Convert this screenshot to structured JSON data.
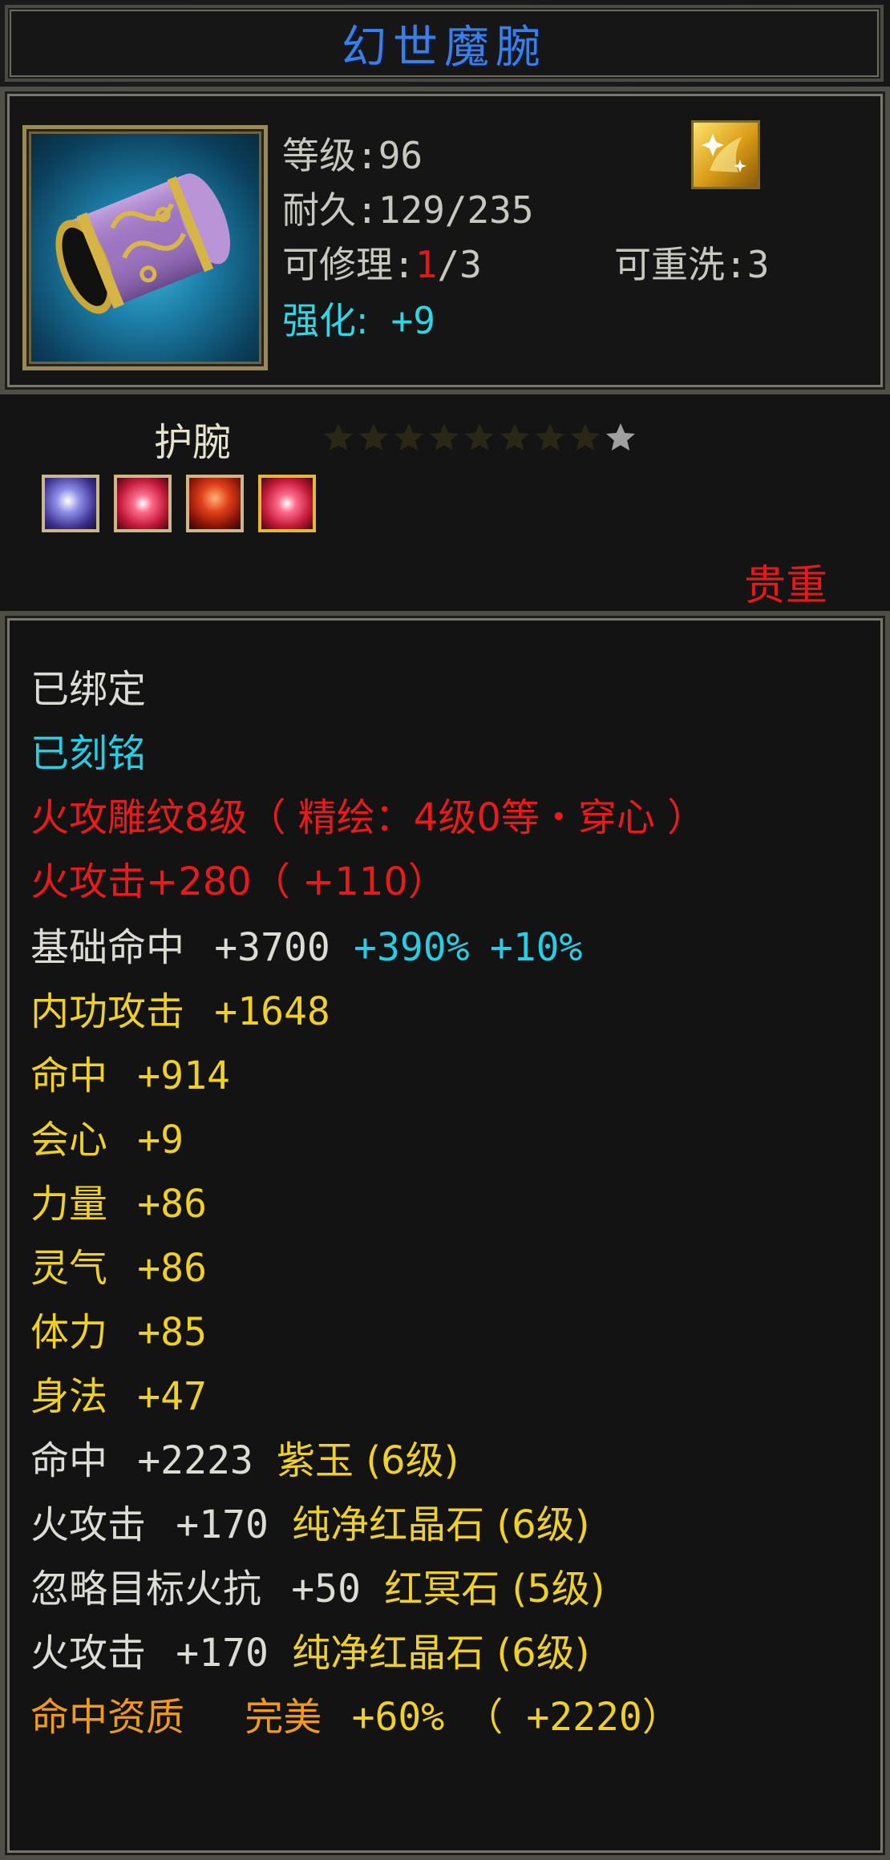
{
  "title": "幻世魔腕",
  "header": {
    "level_label": "等级",
    "level_value": ":96",
    "durability_label": "耐久",
    "durability_value": ":129/235",
    "repair_label": "可修理",
    "repair_colon": ":",
    "repair_used": "1",
    "repair_total": "/3",
    "rewash_label": "可重洗",
    "rewash_value": ":3",
    "enhance_label": "强化:",
    "enhance_value": "+9"
  },
  "item_type": "护腕",
  "stars": {
    "filled": 9,
    "empty_dim": 8,
    "highlight": 1
  },
  "gems": [
    "purple-gem-icon",
    "red-gem-icon",
    "red-crystal-icon",
    "red-gem-icon"
  ],
  "rarity": "贵重",
  "attributes": {
    "bound": "已绑定",
    "engraved": "已刻铭",
    "engraving": "火攻雕纹8级（ 精绘：4级0等・穿心 ）",
    "fire_attack_base": "火攻击+280（ +110）",
    "base_hit_label": "基础命中",
    "base_hit_value": "+3700",
    "base_hit_pct1": "+390%",
    "base_hit_pct2": "+10%",
    "inner_attack_label": "内功攻击",
    "inner_attack_value": "+1648",
    "hit_label": "命中",
    "hit_value": "+914",
    "crit_label": "会心",
    "crit_value": "+9",
    "str_label": "力量",
    "str_value": "+86",
    "spirit_label": "灵气",
    "spirit_value": "+86",
    "vit_label": "体力",
    "vit_value": "+85",
    "agi_label": "身法",
    "agi_value": "+47",
    "gem_lines": [
      {
        "label": "命中",
        "value": "+2223",
        "gem": "紫玉",
        "level": "(6级)"
      },
      {
        "label": "火攻击",
        "value": "+170",
        "gem": "纯净红晶石",
        "level": "(6级)"
      },
      {
        "label": "忽略目标火抗",
        "value": "+50",
        "gem": "红冥石",
        "level": "(5级)"
      },
      {
        "label": "火攻击",
        "value": "+170",
        "gem": "纯净红晶石",
        "level": "(6级)"
      }
    ],
    "aptitude_label": "命中资质",
    "aptitude_grade": "完美",
    "aptitude_value": "+60%",
    "aptitude_extra": "（ +2220）"
  },
  "colors": {
    "title": "#3b7fe6",
    "rarity": "#e81818",
    "enhance": "#2fd6e6",
    "bonus": "#22cfe6",
    "yellow": "#f0d020",
    "orange": "#f09a18"
  }
}
